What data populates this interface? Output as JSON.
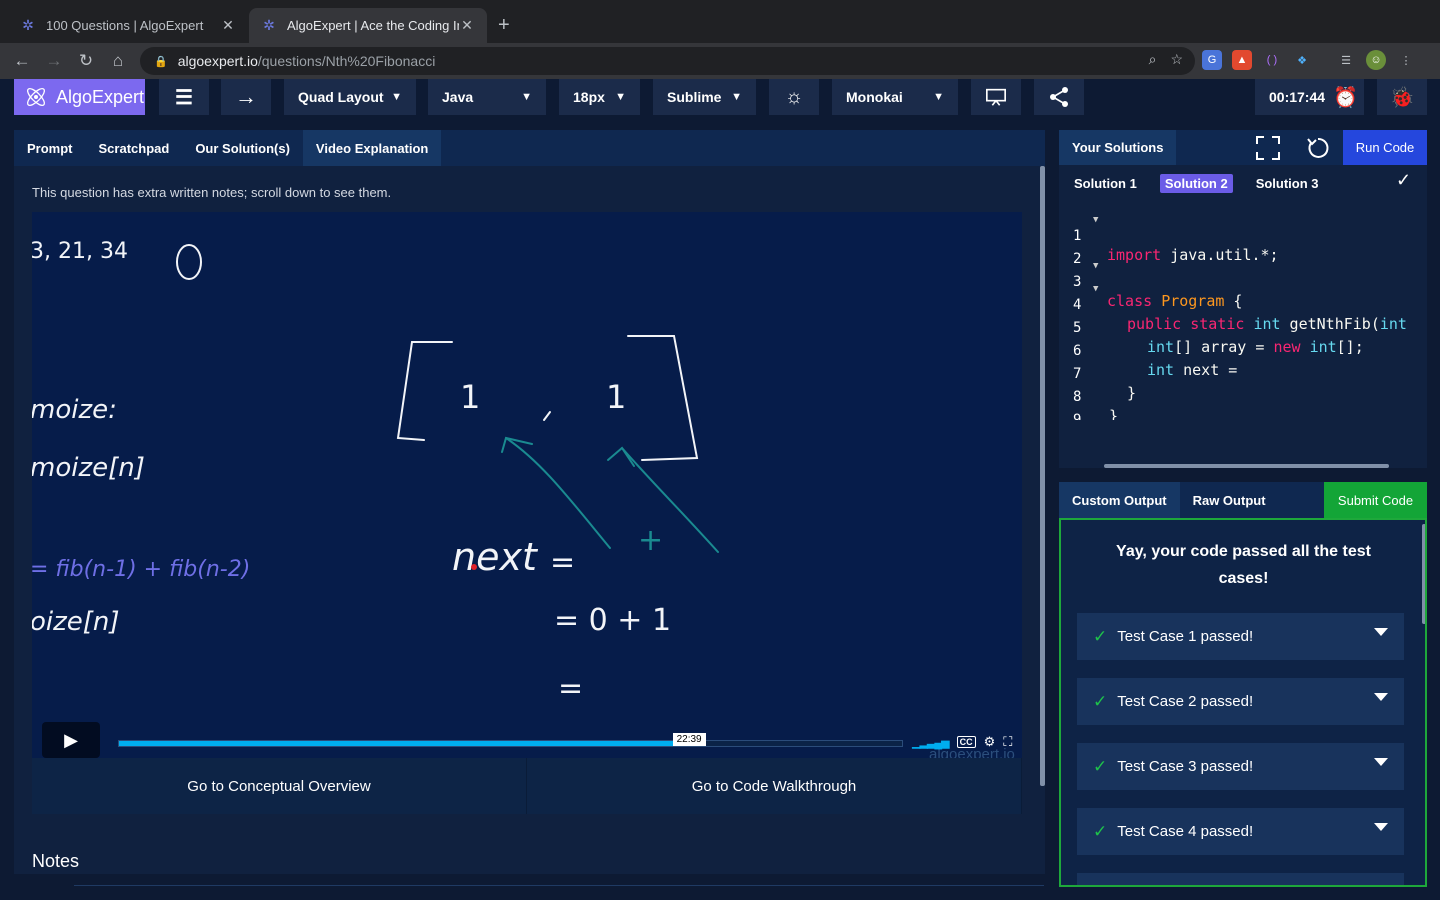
{
  "browser": {
    "tabs": [
      {
        "title": "100 Questions | AlgoExpert",
        "active": false
      },
      {
        "title": "AlgoExpert | Ace the Coding In",
        "active": true
      }
    ],
    "url_host": "algoexpert.io",
    "url_path": "/questions/Nth%20Fibonacci"
  },
  "header": {
    "brand": "AlgoExpert",
    "layout": "Quad Layout",
    "language": "Java",
    "font_size": "18px",
    "keybinding": "Sublime",
    "theme": "Monokai",
    "timer": "00:17:44"
  },
  "left_panel": {
    "tabs": [
      "Prompt",
      "Scratchpad",
      "Our Solution(s)",
      "Video Explanation"
    ],
    "active_tab": "Video Explanation",
    "notice": "This question has extra written notes; scroll down to see them.",
    "video": {
      "timestamp_tooltip": "22:39",
      "progress_fraction": 0.73,
      "watermark": "algoexpert.io",
      "board_text": {
        "top": "3, 21, 34",
        "memoize": "moize:",
        "memoize_n": "moize[n]",
        "fib": "= fib(n-1) + fib(n-2)",
        "memoize_n2": "oize[n]",
        "next": "next",
        "eq1": "=",
        "eq2": "= 0 + 1",
        "eq3": "=",
        "plus": "+",
        "zero": "0",
        "one_a": "1",
        "one_b": "1"
      }
    },
    "nav_prev": "Go to Conceptual Overview",
    "nav_next": "Go to Code Walkthrough",
    "notes_title": "Notes"
  },
  "editor": {
    "title": "Your Solutions",
    "run_label": "Run Code",
    "solution_tabs": [
      "Solution 1",
      "Solution 2",
      "Solution 3"
    ],
    "active_solution": "Solution 2",
    "lines": [
      {
        "n": "1",
        "fold": true
      },
      {
        "n": "2",
        "fold": false
      },
      {
        "n": "3",
        "fold": true
      },
      {
        "n": "4",
        "fold": true
      },
      {
        "n": "5",
        "fold": false
      },
      {
        "n": "6",
        "fold": false
      },
      {
        "n": "7",
        "fold": false
      },
      {
        "n": "8",
        "fold": false
      },
      {
        "n": "9",
        "fold": false
      }
    ],
    "code": {
      "l1_kw": "import",
      "l1_rest": " java.util.*;",
      "l3_kw": "class",
      "l3_cls": "Program",
      "l3_rest": " {",
      "l4_kw": "public static",
      "l4_ty": "int",
      "l4_rest": " getNthFib(",
      "l4_ty2": "int",
      "l5_ty": "int",
      "l5_rest": "[] array = ",
      "l5_kw": "new",
      "l5_ty2": "int",
      "l5_rest2": "[];",
      "l6_ty": "int",
      "l6_rest": " next =",
      "l7": "}",
      "l8": "}"
    }
  },
  "output": {
    "tabs": [
      "Custom Output",
      "Raw Output"
    ],
    "active_tab": "Custom Output",
    "submit_label": "Submit Code",
    "message": "Yay, your code passed all the test cases!",
    "test_cases": [
      "Test Case 1 passed!",
      "Test Case 2 passed!",
      "Test Case 3 passed!",
      "Test Case 4 passed!"
    ]
  },
  "colors": {
    "accent": "#7c69ef",
    "run": "#2547dd",
    "submit": "#13a537",
    "background": "#0d1a33"
  }
}
